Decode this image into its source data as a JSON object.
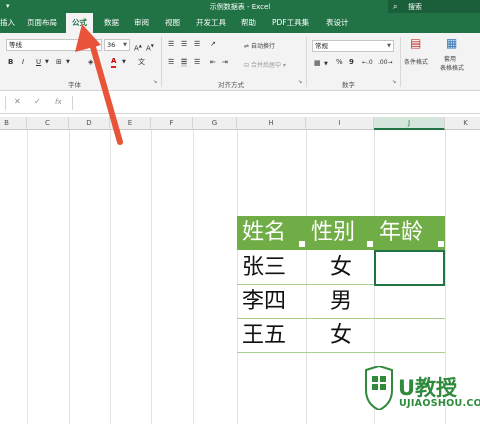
{
  "window": {
    "title": "示例数据表 - Excel",
    "search_label": "搜索",
    "qat": "▾"
  },
  "tabs": [
    {
      "label": "插入"
    },
    {
      "label": "页面布局"
    },
    {
      "label": "公式"
    },
    {
      "label": "数据"
    },
    {
      "label": "审阅"
    },
    {
      "label": "视图"
    },
    {
      "label": "开发工具"
    },
    {
      "label": "帮助"
    },
    {
      "label": "PDF工具集"
    },
    {
      "label": "表设计"
    }
  ],
  "ribbon": {
    "font_name": "等线",
    "font_size": "36",
    "font_group_label": "字体",
    "bold": "B",
    "italic": "I",
    "underline": "U",
    "font_color_icon": "A",
    "wrap_text": "自动换行",
    "merge_center": "合并后居中",
    "align_group_label": "对齐方式",
    "number_format": "常规",
    "number_group_label": "数字",
    "percent": "%",
    "comma": "9",
    "cond_format": "条件格式",
    "table_format_1": "套用",
    "table_format_2": "表格格式"
  },
  "formula_bar": {
    "cancel": "✕",
    "enter": "✓",
    "fx": "fx"
  },
  "columns": [
    "B",
    "C",
    "D",
    "E",
    "F",
    "G",
    "H",
    "I",
    "J",
    "K"
  ],
  "table": {
    "headers": [
      "姓名",
      "性别",
      "年龄"
    ],
    "rows": [
      [
        "张三",
        "女",
        ""
      ],
      [
        "李四",
        "男",
        ""
      ],
      [
        "王五",
        "女",
        ""
      ]
    ]
  },
  "watermark": {
    "logo": "U教授",
    "url": "UJIAOSHOU.COM"
  },
  "colors": {
    "excel_green": "#217346",
    "header_green": "#70ad47",
    "arrow": "#e8543a"
  }
}
